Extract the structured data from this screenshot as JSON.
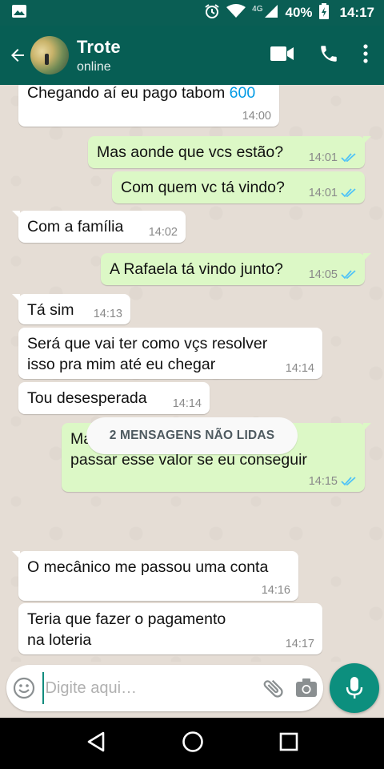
{
  "status_bar": {
    "network_label": "4G",
    "battery_percent": "40%",
    "time": "14:17"
  },
  "header": {
    "contact_name": "Trote",
    "contact_status": "online"
  },
  "messages": [
    {
      "dir": "in",
      "text_main": "Chegando aí eu pago tabom ",
      "text_link": "600",
      "time": "14:00"
    },
    {
      "dir": "out",
      "text": "Mas aonde que vcs estão?",
      "time": "14:01"
    },
    {
      "dir": "out",
      "text": "Com quem vc tá vindo?",
      "time": "14:01"
    },
    {
      "dir": "in",
      "text": "Com a família",
      "time": "14:02"
    },
    {
      "dir": "out",
      "text": "A Rafaela tá vindo junto?",
      "time": "14:05"
    },
    {
      "dir": "in",
      "text": "Tá sim",
      "time": "14:13"
    },
    {
      "dir": "in",
      "line1": "Será que vai ter como vçs resolver",
      "line2": "isso pra mim até eu chegar",
      "time": "14:14"
    },
    {
      "dir": "in",
      "text": "Tou desesperada",
      "time": "14:14"
    },
    {
      "dir": "out",
      "line1": "Mas como que vou fazer pra te",
      "line2": "passar esse valor se eu conseguir",
      "time": "14:15"
    },
    {
      "dir": "in",
      "text": "O mecânico me passou uma conta",
      "time": "14:16"
    },
    {
      "dir": "in",
      "line1": "Teria que fazer o pagamento",
      "line2": "na loteria",
      "time": "14:17"
    }
  ],
  "unread_divider": "2 MENSAGENS NÃO LIDAS",
  "composer": {
    "placeholder": "Digite aqui…",
    "value": ""
  },
  "icons": {
    "tick": "double-check-icon",
    "accent": "#075e54",
    "outgoing_bubble": "#dcf8c6",
    "read_tick_color": "#4fc3f7"
  }
}
